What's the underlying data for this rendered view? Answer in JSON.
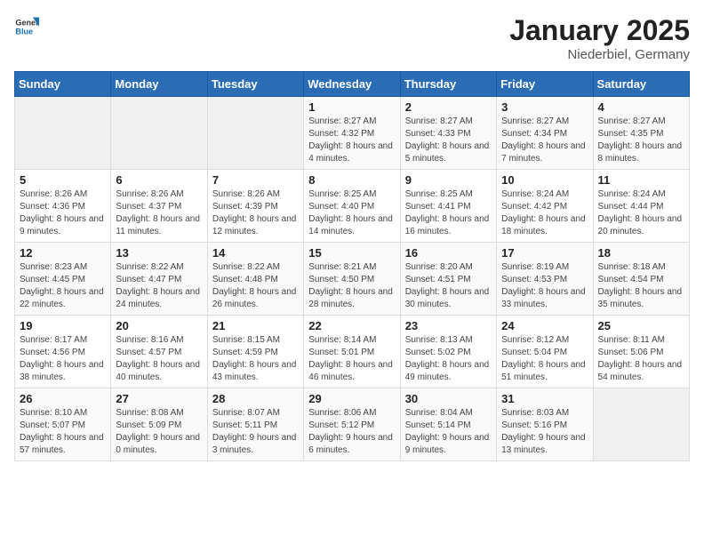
{
  "header": {
    "logo_general": "General",
    "logo_blue": "Blue",
    "month": "January 2025",
    "location": "Niederbiel, Germany"
  },
  "weekdays": [
    "Sunday",
    "Monday",
    "Tuesday",
    "Wednesday",
    "Thursday",
    "Friday",
    "Saturday"
  ],
  "weeks": [
    [
      {
        "day": "",
        "info": ""
      },
      {
        "day": "",
        "info": ""
      },
      {
        "day": "",
        "info": ""
      },
      {
        "day": "1",
        "info": "Sunrise: 8:27 AM\nSunset: 4:32 PM\nDaylight: 8 hours\nand 4 minutes."
      },
      {
        "day": "2",
        "info": "Sunrise: 8:27 AM\nSunset: 4:33 PM\nDaylight: 8 hours\nand 5 minutes."
      },
      {
        "day": "3",
        "info": "Sunrise: 8:27 AM\nSunset: 4:34 PM\nDaylight: 8 hours\nand 7 minutes."
      },
      {
        "day": "4",
        "info": "Sunrise: 8:27 AM\nSunset: 4:35 PM\nDaylight: 8 hours\nand 8 minutes."
      }
    ],
    [
      {
        "day": "5",
        "info": "Sunrise: 8:26 AM\nSunset: 4:36 PM\nDaylight: 8 hours\nand 9 minutes."
      },
      {
        "day": "6",
        "info": "Sunrise: 8:26 AM\nSunset: 4:37 PM\nDaylight: 8 hours\nand 11 minutes."
      },
      {
        "day": "7",
        "info": "Sunrise: 8:26 AM\nSunset: 4:39 PM\nDaylight: 8 hours\nand 12 minutes."
      },
      {
        "day": "8",
        "info": "Sunrise: 8:25 AM\nSunset: 4:40 PM\nDaylight: 8 hours\nand 14 minutes."
      },
      {
        "day": "9",
        "info": "Sunrise: 8:25 AM\nSunset: 4:41 PM\nDaylight: 8 hours\nand 16 minutes."
      },
      {
        "day": "10",
        "info": "Sunrise: 8:24 AM\nSunset: 4:42 PM\nDaylight: 8 hours\nand 18 minutes."
      },
      {
        "day": "11",
        "info": "Sunrise: 8:24 AM\nSunset: 4:44 PM\nDaylight: 8 hours\nand 20 minutes."
      }
    ],
    [
      {
        "day": "12",
        "info": "Sunrise: 8:23 AM\nSunset: 4:45 PM\nDaylight: 8 hours\nand 22 minutes."
      },
      {
        "day": "13",
        "info": "Sunrise: 8:22 AM\nSunset: 4:47 PM\nDaylight: 8 hours\nand 24 minutes."
      },
      {
        "day": "14",
        "info": "Sunrise: 8:22 AM\nSunset: 4:48 PM\nDaylight: 8 hours\nand 26 minutes."
      },
      {
        "day": "15",
        "info": "Sunrise: 8:21 AM\nSunset: 4:50 PM\nDaylight: 8 hours\nand 28 minutes."
      },
      {
        "day": "16",
        "info": "Sunrise: 8:20 AM\nSunset: 4:51 PM\nDaylight: 8 hours\nand 30 minutes."
      },
      {
        "day": "17",
        "info": "Sunrise: 8:19 AM\nSunset: 4:53 PM\nDaylight: 8 hours\nand 33 minutes."
      },
      {
        "day": "18",
        "info": "Sunrise: 8:18 AM\nSunset: 4:54 PM\nDaylight: 8 hours\nand 35 minutes."
      }
    ],
    [
      {
        "day": "19",
        "info": "Sunrise: 8:17 AM\nSunset: 4:56 PM\nDaylight: 8 hours\nand 38 minutes."
      },
      {
        "day": "20",
        "info": "Sunrise: 8:16 AM\nSunset: 4:57 PM\nDaylight: 8 hours\nand 40 minutes."
      },
      {
        "day": "21",
        "info": "Sunrise: 8:15 AM\nSunset: 4:59 PM\nDaylight: 8 hours\nand 43 minutes."
      },
      {
        "day": "22",
        "info": "Sunrise: 8:14 AM\nSunset: 5:01 PM\nDaylight: 8 hours\nand 46 minutes."
      },
      {
        "day": "23",
        "info": "Sunrise: 8:13 AM\nSunset: 5:02 PM\nDaylight: 8 hours\nand 49 minutes."
      },
      {
        "day": "24",
        "info": "Sunrise: 8:12 AM\nSunset: 5:04 PM\nDaylight: 8 hours\nand 51 minutes."
      },
      {
        "day": "25",
        "info": "Sunrise: 8:11 AM\nSunset: 5:06 PM\nDaylight: 8 hours\nand 54 minutes."
      }
    ],
    [
      {
        "day": "26",
        "info": "Sunrise: 8:10 AM\nSunset: 5:07 PM\nDaylight: 8 hours\nand 57 minutes."
      },
      {
        "day": "27",
        "info": "Sunrise: 8:08 AM\nSunset: 5:09 PM\nDaylight: 9 hours\nand 0 minutes."
      },
      {
        "day": "28",
        "info": "Sunrise: 8:07 AM\nSunset: 5:11 PM\nDaylight: 9 hours\nand 3 minutes."
      },
      {
        "day": "29",
        "info": "Sunrise: 8:06 AM\nSunset: 5:12 PM\nDaylight: 9 hours\nand 6 minutes."
      },
      {
        "day": "30",
        "info": "Sunrise: 8:04 AM\nSunset: 5:14 PM\nDaylight: 9 hours\nand 9 minutes."
      },
      {
        "day": "31",
        "info": "Sunrise: 8:03 AM\nSunset: 5:16 PM\nDaylight: 9 hours\nand 13 minutes."
      },
      {
        "day": "",
        "info": ""
      }
    ]
  ]
}
